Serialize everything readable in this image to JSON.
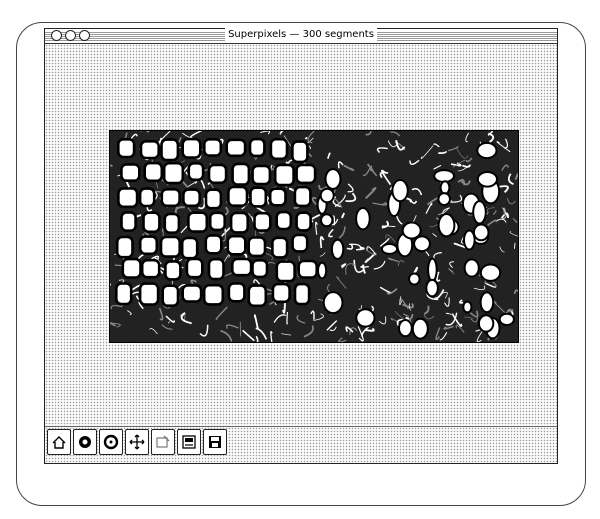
{
  "window": {
    "title": "Superpixels — 300 segments"
  },
  "image": {
    "description_icon": "superpixel-segmentation-image"
  },
  "toolbar": {
    "buttons": [
      {
        "icon": "home-icon"
      },
      {
        "icon": "back-icon"
      },
      {
        "icon": "forward-icon"
      },
      {
        "icon": "pan-icon"
      },
      {
        "icon": "zoom-icon"
      },
      {
        "icon": "subplots-icon"
      },
      {
        "icon": "save-icon"
      }
    ]
  }
}
